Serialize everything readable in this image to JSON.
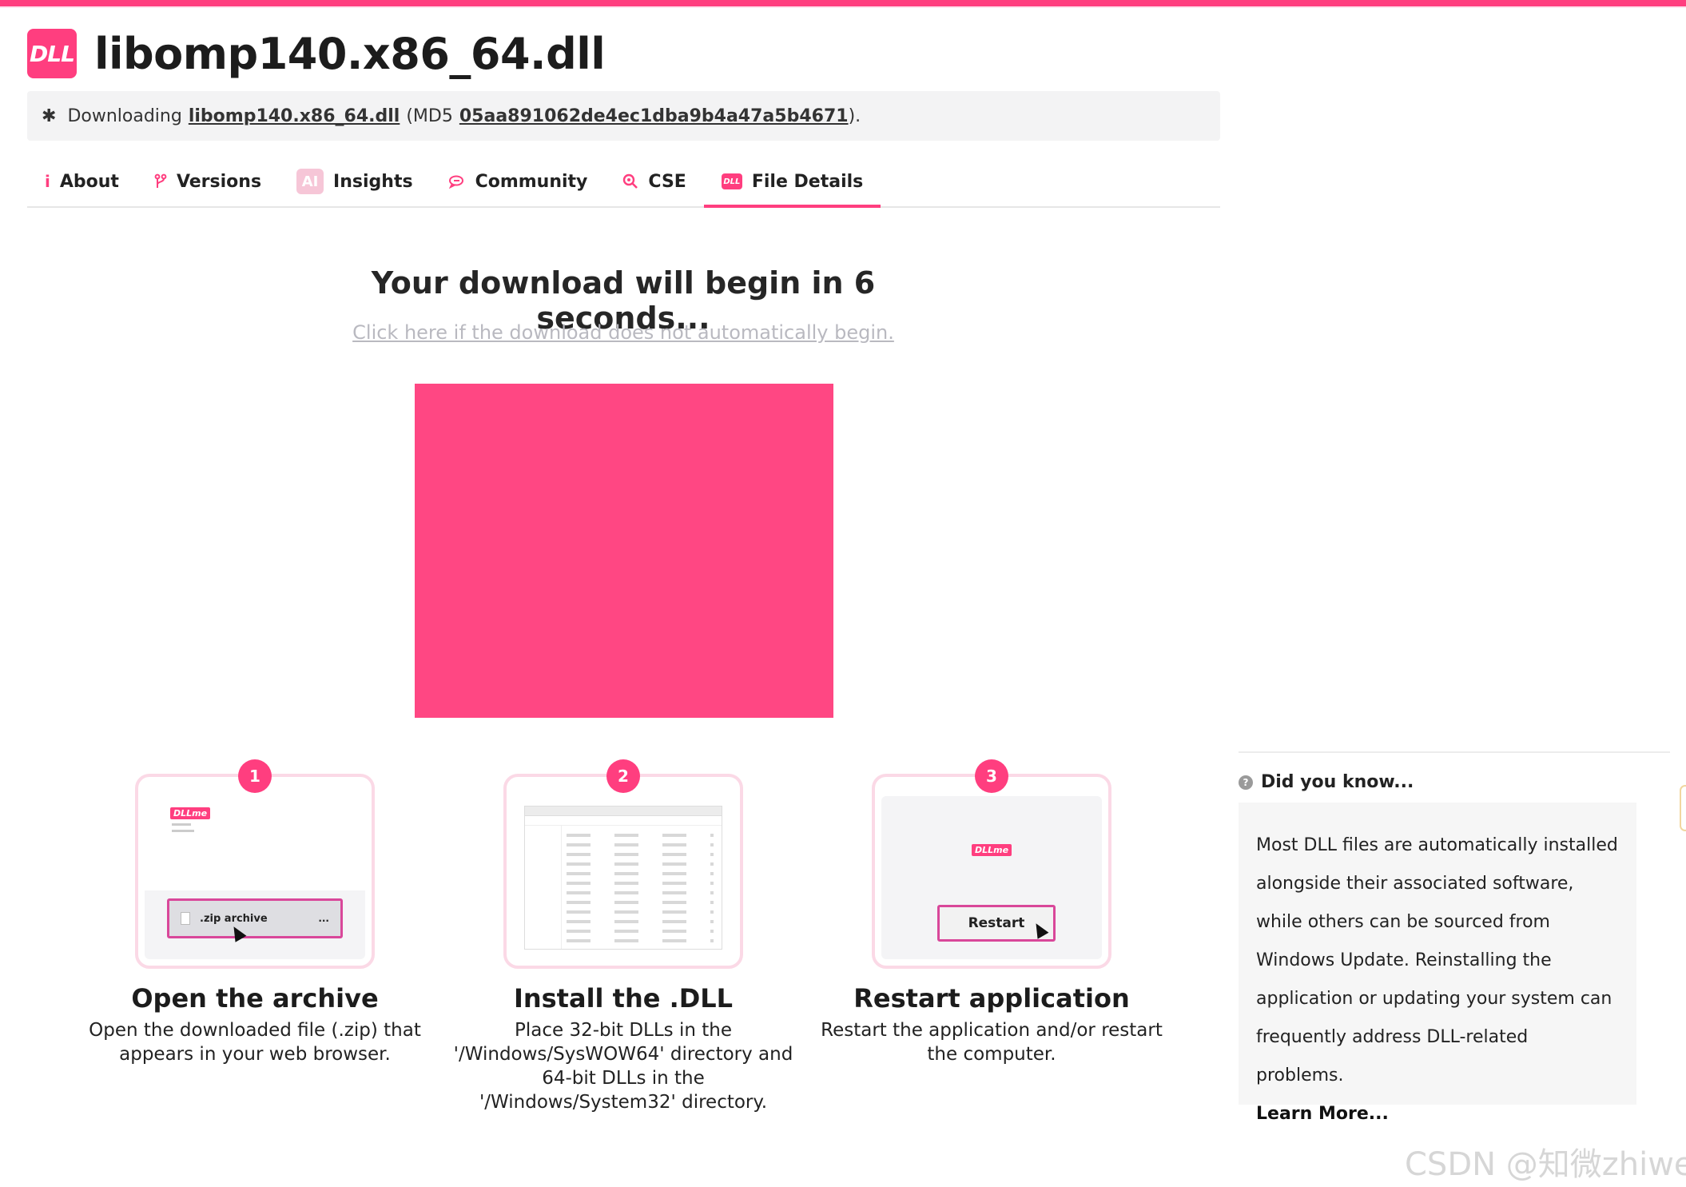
{
  "header": {
    "badge": "DLL",
    "title": "libomp140.x86_64.dll"
  },
  "download_bar": {
    "prefix": "Downloading",
    "file_link": "libomp140.x86_64.dll",
    "md5_open": "(MD5",
    "md5_value": "05aa891062de4ec1dba9b4a47a5b4671",
    "md5_close": ")."
  },
  "tabs": [
    {
      "label": "About",
      "icon": "info-icon"
    },
    {
      "label": "Versions",
      "icon": "branch-icon"
    },
    {
      "label": "Insights",
      "icon": "ai-icon",
      "icon_text": "AI"
    },
    {
      "label": "Community",
      "icon": "chat-icon"
    },
    {
      "label": "CSE",
      "icon": "search-icon"
    },
    {
      "label": "File Details",
      "icon": "dll-icon",
      "icon_text": "DLL",
      "active": true
    }
  ],
  "countdown": {
    "message": "Your download will begin in 6 seconds...",
    "manual_link": "Click here if the download does not automatically begin."
  },
  "steps": [
    {
      "number": "1",
      "title": "Open the archive",
      "desc": "Open the downloaded file (.zip) that appears in your web browser.",
      "mock_logo": "DLLme",
      "mock_label": ".zip archive",
      "mock_dots": "..."
    },
    {
      "number": "2",
      "title": "Install the .DLL",
      "desc": "Place 32-bit DLLs in the '/Windows/SysWOW64' directory and 64-bit DLLs in the '/Windows/System32' directory."
    },
    {
      "number": "3",
      "title": "Restart application",
      "desc": "Restart the application and/or restart the computer.",
      "mock_logo": "DLLme",
      "mock_label": "Restart"
    }
  ],
  "did_you_know": {
    "title": "Did you know...",
    "body": "Most DLL files are automatically installed alongside their associated software, while others can be sourced from Windows Update. Reinstalling the application or updating your system can frequently address DLL-related problems.",
    "learn_more": "Learn More..."
  },
  "watermark": "CSDN @知微zhiwei",
  "colors": {
    "accent": "#ff3e7f",
    "ad": "#ff4783",
    "sidebar_bg": "#f6f6f6"
  }
}
